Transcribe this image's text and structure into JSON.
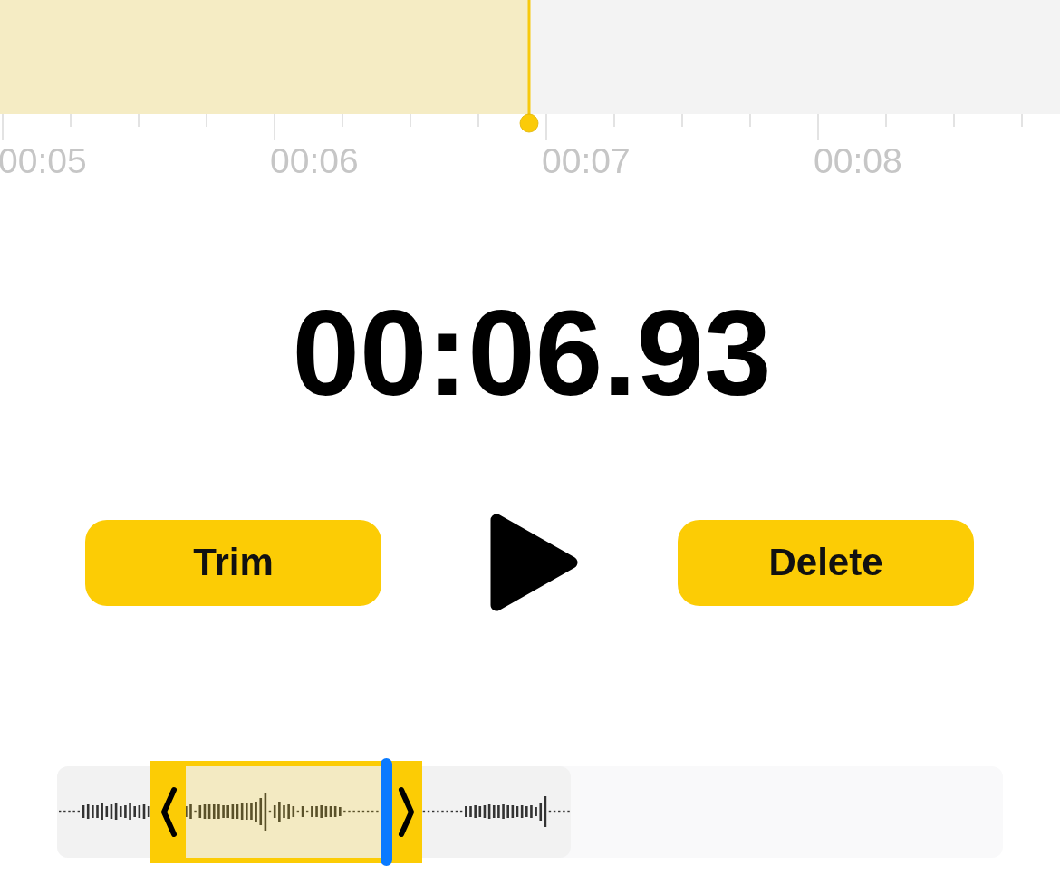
{
  "timeline": {
    "played": {
      "level": 0.499
    },
    "ticks": [
      "00:05",
      "00:06",
      "00:07",
      "00:08"
    ]
  },
  "timer": "00:06.93",
  "controls": [
    {
      "kind": "button",
      "label": "Trim"
    },
    {
      "kind": "play"
    },
    {
      "kind": "button",
      "label": "Delete"
    }
  ],
  "scrubber": {
    "recorded": {
      "level": 0.543
    },
    "playhead": {
      "level": 0.348
    }
  }
}
